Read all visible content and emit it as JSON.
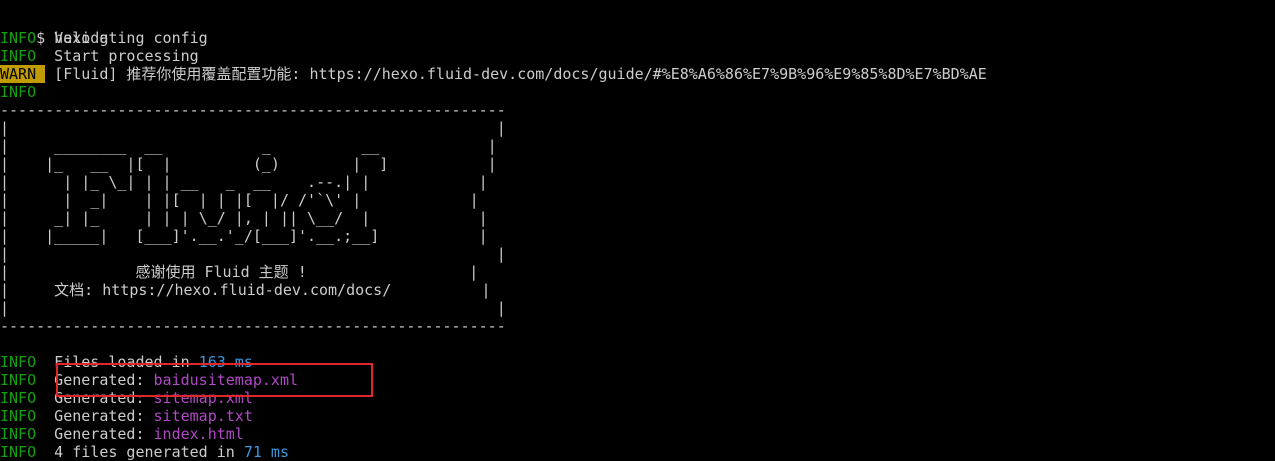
{
  "colors": {
    "background": "#000000",
    "text": "#cccccc",
    "info": "#13a10e",
    "warn_bg": "#c19c00",
    "number": "#3a96dd",
    "file": "#b148c6",
    "highlight_box": "#e0282a"
  },
  "prompt": "$ hexo g",
  "log": {
    "info_tag": "INFO ",
    "warn_tag": "WARN ",
    "validating": " Validating config",
    "processing": " Start processing",
    "warn_message": " [Fluid] 推荐你使用覆盖配置功能: https://hexo.fluid-dev.com/docs/guide/#%E8%A6%86%E7%9B%96%E9%85%8D%E7%BD%AE"
  },
  "banner": {
    "border": "--------------------------------------------------------",
    "lines": [
      "|                                                      |",
      "|     ________  __           _          __            |",
      "|    |_   __  |[  |         (_)        |  ]           |",
      "|      | |_ \\_| | | __   _  __    .--.| |            |",
      "|      |  _|    | |[  | | |[  |/ /'`\\' |            |",
      "|     _| |_     | | | \\_/ |, | || \\__/  |            |",
      "|    |_____|   [___]'.__.'_/[___]'.__.;__]           |",
      "|                                                      |",
      "|              感谢使用 Fluid 主题 !                  |",
      "|     文档: https://hexo.fluid-dev.com/docs/          |",
      "|                                                      |"
    ]
  },
  "summary": {
    "files_loaded_prefix": " Files loaded in ",
    "files_loaded_value": "163 ms",
    "generated_prefix": " Generated: ",
    "generated_files": [
      "baidusitemap.xml",
      "sitemap.xml",
      "sitemap.txt",
      "index.html"
    ],
    "total_prefix": " 4 files generated in ",
    "total_value": "71 ms"
  }
}
